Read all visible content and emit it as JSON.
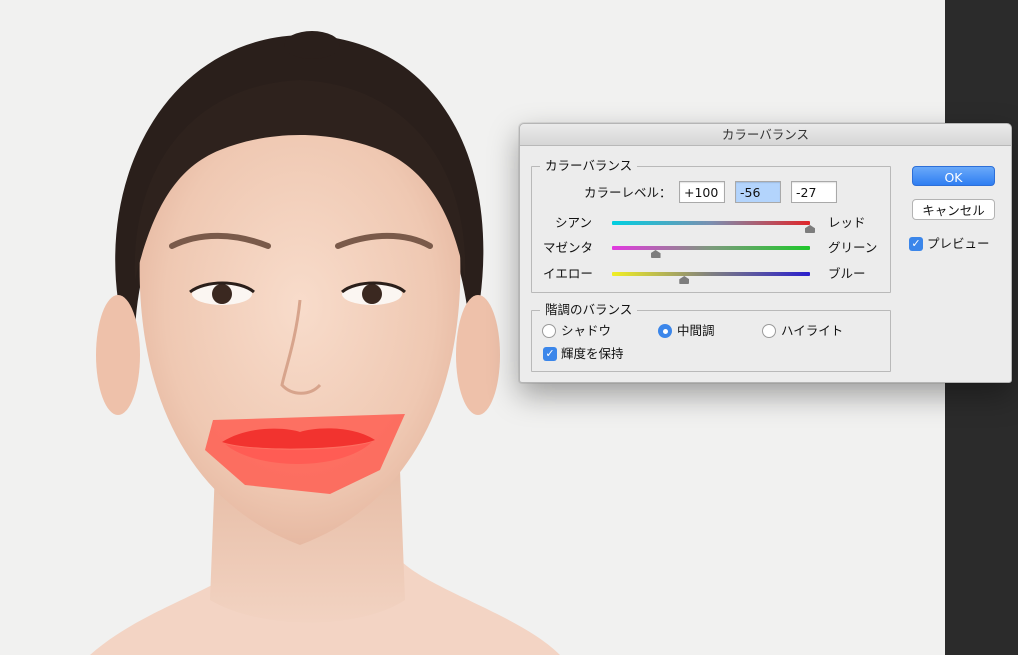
{
  "dialog": {
    "title": "カラーバランス",
    "color_balance_group": {
      "legend": "カラーバランス",
      "levels_label": "カラーレベル：",
      "levels": [
        "+100",
        "-56",
        "-27"
      ],
      "sliders": [
        {
          "left_label": "シアン",
          "right_label": "レッド",
          "value": 100
        },
        {
          "left_label": "マゼンタ",
          "right_label": "グリーン",
          "value": -56
        },
        {
          "left_label": "イエロー",
          "right_label": "ブルー",
          "value": -27
        }
      ]
    },
    "tone_group": {
      "legend": "階調のバランス",
      "options": [
        "シャドウ",
        "中間調",
        "ハイライト"
      ],
      "selected": "中間調",
      "preserve_luminosity_label": "輝度を保持",
      "preserve_luminosity": true
    },
    "buttons": {
      "ok": "OK",
      "cancel": "キャンセル"
    },
    "preview_label": "プレビュー",
    "preview": true
  },
  "colors": {
    "accent": "#3b86ea",
    "lip_mask": "#ff5a4e",
    "workspace_dark": "#2b2b2b"
  }
}
